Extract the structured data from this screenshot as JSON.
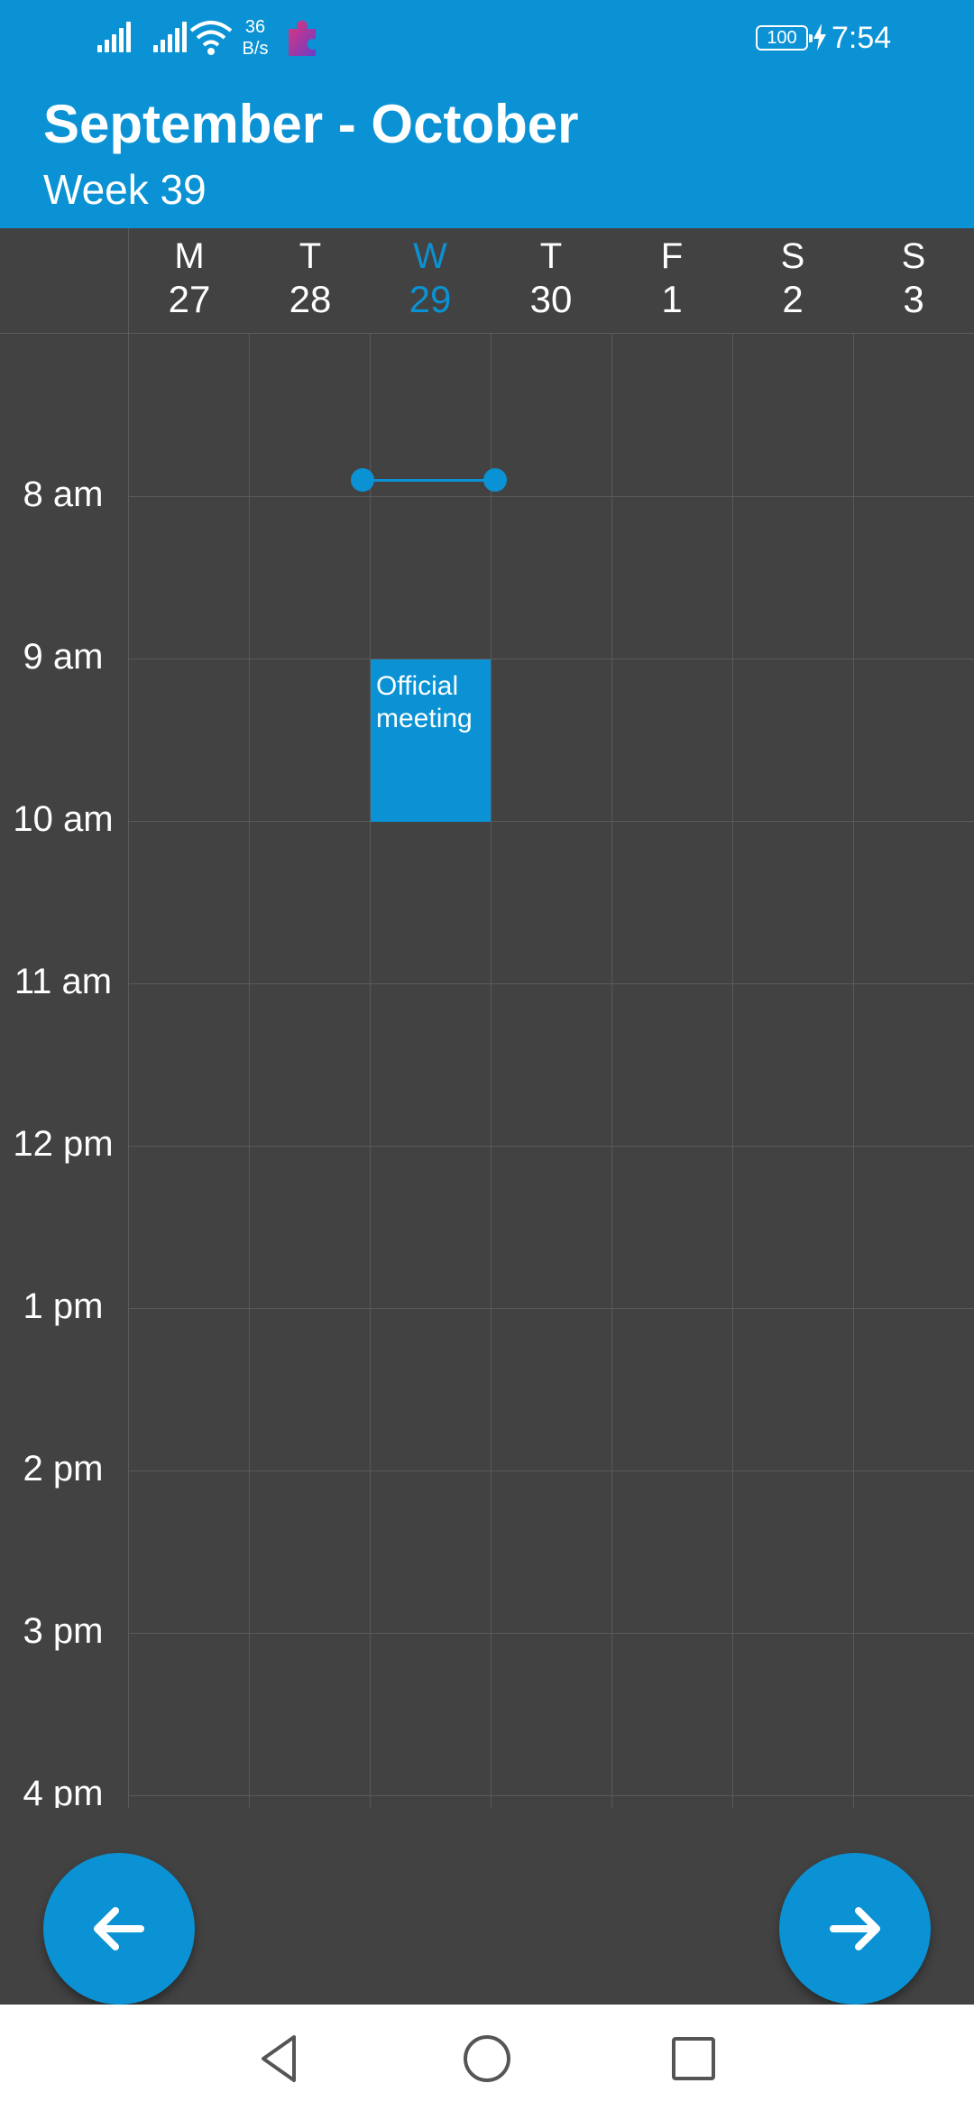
{
  "status_bar": {
    "net_speed_value": "36",
    "net_speed_unit": "B/s",
    "battery": "100",
    "time": "7:54"
  },
  "header": {
    "title": "September - October",
    "subtitle": "Week 39"
  },
  "days": [
    {
      "letter": "M",
      "date": "27"
    },
    {
      "letter": "T",
      "date": "28"
    },
    {
      "letter": "W",
      "date": "29"
    },
    {
      "letter": "T",
      "date": "30"
    },
    {
      "letter": "F",
      "date": "1"
    },
    {
      "letter": "S",
      "date": "2"
    },
    {
      "letter": "S",
      "date": "3"
    }
  ],
  "hours": [
    "8 am",
    "9 am",
    "10 am",
    "11 am",
    "12 pm",
    "1 pm",
    "2 pm",
    "3 pm",
    "4 pm"
  ],
  "event": {
    "title": "Official meeting"
  },
  "icons": {
    "prev": "arrow-left-icon",
    "next": "arrow-right-icon",
    "nav_back": "triangle-back-icon",
    "nav_home": "circle-home-icon",
    "nav_recents": "square-recents-icon"
  },
  "colors": {
    "accent": "#0a92d4",
    "background": "#424242",
    "grid_line": "#5a5a5a"
  }
}
